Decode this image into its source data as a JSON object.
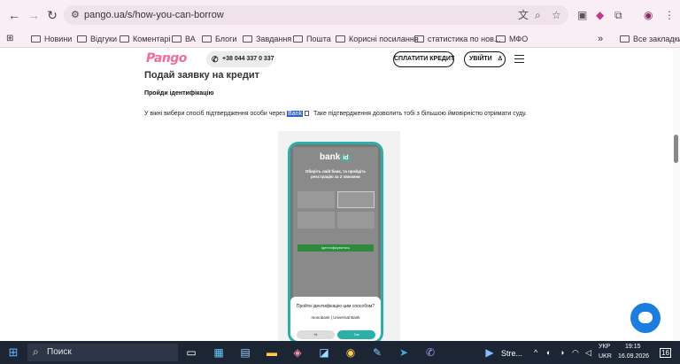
{
  "browser": {
    "url": "pango.ua/s/how-you-can-borrow",
    "bookmarks": [
      "Новини",
      "Відгуки",
      "Коментарі",
      "ВА",
      "Блоги",
      "Завдання",
      "Пошта",
      "Корисні посилання",
      "статистика по нов...",
      "МФО"
    ],
    "all_bookmarks": "Все закладки",
    "more_bookmarks": "»"
  },
  "site": {
    "logo": "Pango",
    "phone": "+38 044 337 0 337",
    "pay_button": "СПЛАТИТИ КРЕДИТ",
    "login_button": "УВІЙТИ"
  },
  "content": {
    "heading": "Подай заявку на кредит",
    "subheading": "Пройди ідентифікацію",
    "para_before": "У вікні вибери спосіб підтвердження особи через ",
    "para_highlight": "Bank",
    "para_after": " Таке підтвердження дозволить тобі з більшою ймовірністю отримати суду."
  },
  "mockup": {
    "brand": "bank",
    "brand_suffix": "id",
    "prompt_line1": "Оберіть свій банк, та пройдіть",
    "prompt_line2": "реєстрацію за 2 хвилини",
    "green_button": "Ідентифікуватись",
    "sheet_question": "Пройти ідентифікацію цим способом?",
    "sheet_bank": "monobank | Universal Bank",
    "no_button": "Ні",
    "yes_button": "Так"
  },
  "taskbar": {
    "search_placeholder": "Поиск",
    "app_label": "Stre...",
    "lang_top": "УКР",
    "lang_bottom": "UKR",
    "time": "19:15",
    "date": "16.09.2026",
    "notifications": "16"
  }
}
